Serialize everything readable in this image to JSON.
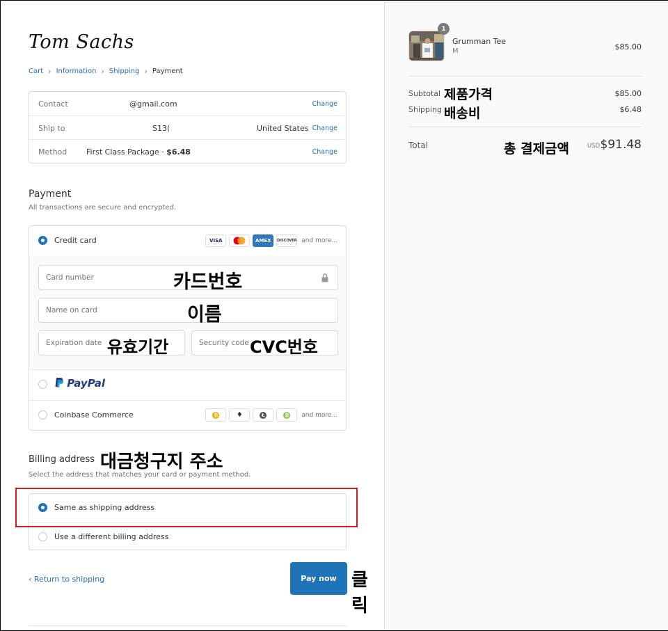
{
  "brand": {
    "logo": "Tom Sachs"
  },
  "breadcrumb": {
    "cart": "Cart",
    "information": "Information",
    "shipping": "Shipping",
    "payment": "Payment"
  },
  "review": {
    "contact_label": "Contact",
    "contact_value": "@gmail.com",
    "shipto_label": "Ship to",
    "shipto_value": "S13(",
    "shipto_country": "United States",
    "method_label": "Method",
    "method_value": "First Class Package · ",
    "method_price": "$6.48",
    "change": "Change"
  },
  "payment": {
    "title": "Payment",
    "subtitle": "All transactions are secure and encrypted.",
    "credit_card": "Credit card",
    "card_logos": [
      "VISA",
      "",
      "AMEX",
      "DISCOVER"
    ],
    "and_more": "and more...",
    "card_number_ph": "Card number",
    "name_ph": "Name on card",
    "expiry_ph": "Expiration date",
    "cvc_ph": "Security code",
    "paypal": "PayPal",
    "coinbase": "Coinbase Commerce",
    "notes": {
      "card_number": "카드번호",
      "name": "이름",
      "expiry": "유효기간",
      "cvc": "CVC번호"
    }
  },
  "billing": {
    "title": "Billing address",
    "note": "대금청구지 주소",
    "subtitle": "Select the address that matches your card or payment method.",
    "same": "Same as shipping address",
    "different": "Use a different billing address"
  },
  "actions": {
    "back": "Return to shipping",
    "pay": "Pay now",
    "click_note": "클릭"
  },
  "summary": {
    "product_name": "Grumman Tee",
    "product_variant": "M",
    "product_price": "$85.00",
    "quantity": "1",
    "subtotal_label": "Subtotal",
    "subtotal_note": "제품가격",
    "subtotal_value": "$85.00",
    "shipping_label": "Shipping",
    "shipping_note": "배송비",
    "shipping_value": "$6.48",
    "total_label": "Total",
    "total_note": "총 결제금액",
    "currency": "USD",
    "total_value": "$91.48"
  },
  "colors": {
    "accent": "#1f74b8",
    "link": "#2a6fa8",
    "highlight": "#cc1f1f"
  }
}
